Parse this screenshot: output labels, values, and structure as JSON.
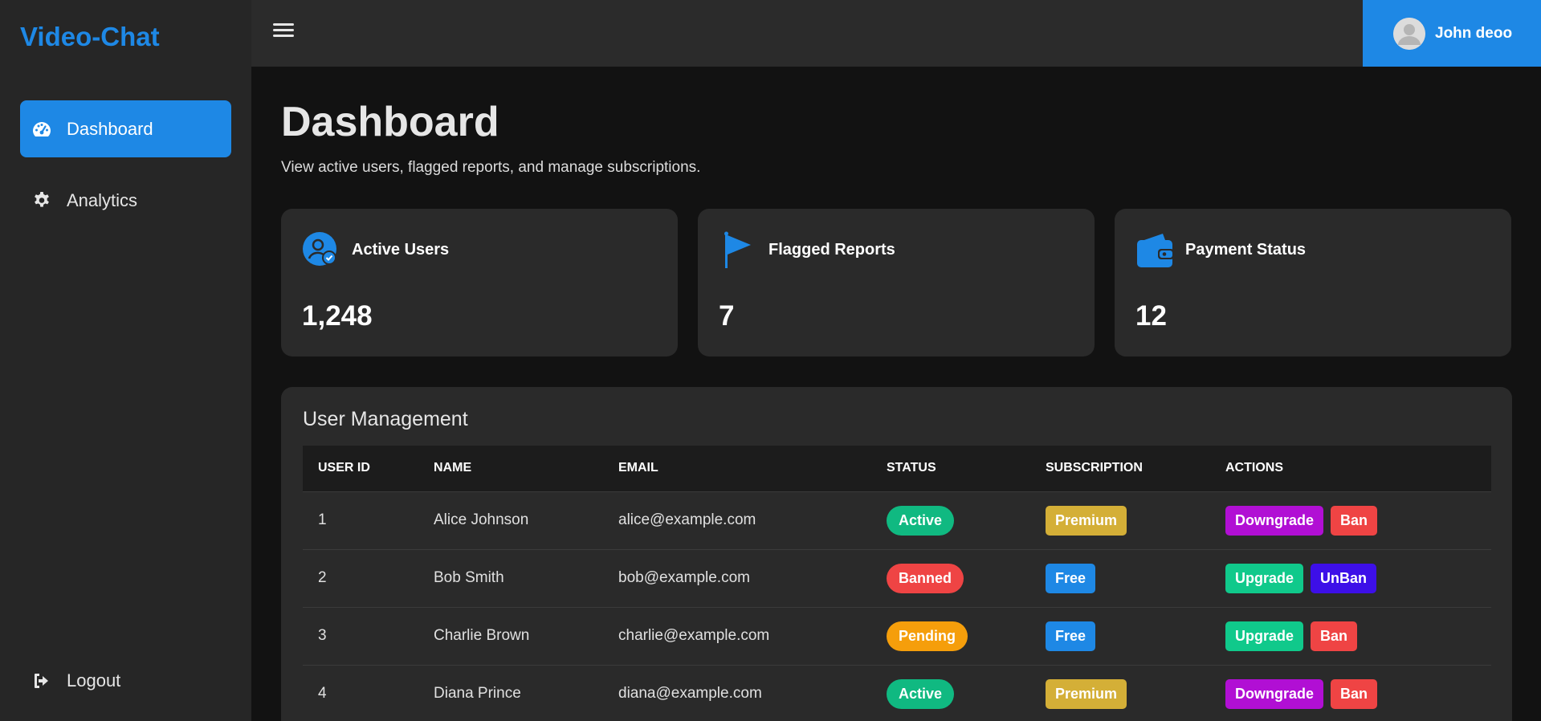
{
  "brand": "Video-Chat",
  "sidebar": {
    "items": [
      {
        "label": "Dashboard",
        "icon": "gauge-icon",
        "active": true
      },
      {
        "label": "Analytics",
        "icon": "gear-icon",
        "active": false
      }
    ],
    "logout": {
      "label": "Logout",
      "icon": "logout-icon"
    }
  },
  "topbar": {
    "menu_icon": "hamburger-icon",
    "user": {
      "name": "John deoo",
      "avatar": "avatar-icon"
    }
  },
  "main": {
    "title": "Dashboard",
    "subtitle": "View active users, flagged reports, and manage subscriptions."
  },
  "stats": [
    {
      "title": "Active Users",
      "value": "1,248",
      "icon": "user-check-icon"
    },
    {
      "title": "Flagged Reports",
      "value": "7",
      "icon": "flag-icon"
    },
    {
      "title": "Payment Status",
      "value": "12",
      "icon": "wallet-icon"
    }
  ],
  "table": {
    "title": "User Management",
    "headers": [
      "USER ID",
      "NAME",
      "EMAIL",
      "STATUS",
      "SUBSCRIPTION",
      "ACTIONS"
    ],
    "rows": [
      {
        "id": "1",
        "name": "Alice Johnson",
        "email": "alice@example.com",
        "status": "Active",
        "subscription": "Premium",
        "action1": "Downgrade",
        "action2": "Ban"
      },
      {
        "id": "2",
        "name": "Bob Smith",
        "email": "bob@example.com",
        "status": "Banned",
        "subscription": "Free",
        "action1": "Upgrade",
        "action2": "UnBan"
      },
      {
        "id": "3",
        "name": "Charlie Brown",
        "email": "charlie@example.com",
        "status": "Pending",
        "subscription": "Free",
        "action1": "Upgrade",
        "action2": "Ban"
      },
      {
        "id": "4",
        "name": "Diana Prince",
        "email": "diana@example.com",
        "status": "Active",
        "subscription": "Premium",
        "action1": "Downgrade",
        "action2": "Ban"
      }
    ]
  },
  "colors": {
    "accent": "#1e88e5",
    "status_active": "#10b981",
    "status_banned": "#ef4444",
    "status_pending": "#f59e0b",
    "sub_premium": "#d4af37",
    "sub_free": "#1e88e5",
    "btn_downgrade": "#b10fd4",
    "btn_upgrade": "#10c98b",
    "btn_ban": "#ef4444",
    "btn_unban": "#3d0fe8"
  }
}
